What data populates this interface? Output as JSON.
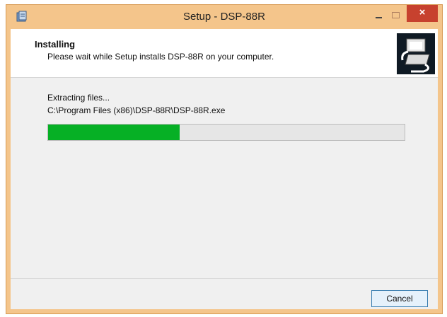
{
  "window": {
    "title": "Setup - DSP-88R",
    "close_label": "×"
  },
  "header": {
    "title": "Installing",
    "subtitle": "Please wait while Setup installs DSP-88R on your computer."
  },
  "status": {
    "text": "Extracting files...",
    "path": "C:\\Program Files (x86)\\DSP-88R\\DSP-88R.exe"
  },
  "progress": {
    "value": 0.37,
    "color": "#06b025"
  },
  "buttons": {
    "cancel": "Cancel"
  },
  "icons": {
    "app": "installer-icon",
    "header": "computer-install-icon"
  }
}
